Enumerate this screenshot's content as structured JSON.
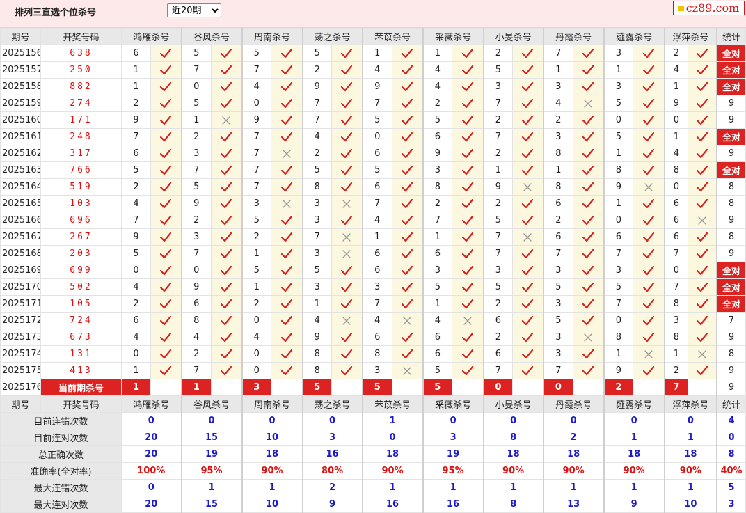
{
  "title": "排列三直选个位杀号",
  "period_select": {
    "value": "近20期"
  },
  "logo_text": "cz89.com",
  "header": {
    "issue_col": "期号",
    "draw_col": "开奖号码",
    "experts": [
      "鸿雁杀号",
      "谷风杀号",
      "周南杀号",
      "荡之杀号",
      "芣苡杀号",
      "采薇杀号",
      "小旻杀号",
      "丹霞杀号",
      "薤露杀号",
      "浮萍杀号"
    ],
    "stat_col": "统计"
  },
  "rows": [
    {
      "issue": "2025156",
      "draw": "638",
      "kills": [
        [
          6,
          1
        ],
        [
          5,
          1
        ],
        [
          5,
          1
        ],
        [
          5,
          1
        ],
        [
          1,
          1
        ],
        [
          1,
          1
        ],
        [
          2,
          1
        ],
        [
          7,
          1
        ],
        [
          3,
          1
        ],
        [
          2,
          1
        ]
      ],
      "total": "全对"
    },
    {
      "issue": "2025157",
      "draw": "250",
      "kills": [
        [
          1,
          1
        ],
        [
          7,
          1
        ],
        [
          7,
          1
        ],
        [
          2,
          1
        ],
        [
          4,
          1
        ],
        [
          4,
          1
        ],
        [
          5,
          1
        ],
        [
          1,
          1
        ],
        [
          1,
          1
        ],
        [
          4,
          1
        ]
      ],
      "total": "全对"
    },
    {
      "issue": "2025158",
      "draw": "882",
      "kills": [
        [
          1,
          1
        ],
        [
          0,
          1
        ],
        [
          4,
          1
        ],
        [
          9,
          1
        ],
        [
          9,
          1
        ],
        [
          4,
          1
        ],
        [
          3,
          1
        ],
        [
          3,
          1
        ],
        [
          3,
          1
        ],
        [
          1,
          1
        ]
      ],
      "total": "全对"
    },
    {
      "issue": "2025159",
      "draw": "274",
      "kills": [
        [
          2,
          1
        ],
        [
          5,
          1
        ],
        [
          0,
          1
        ],
        [
          7,
          1
        ],
        [
          7,
          1
        ],
        [
          2,
          1
        ],
        [
          7,
          1
        ],
        [
          4,
          0
        ],
        [
          5,
          1
        ],
        [
          9,
          1
        ]
      ],
      "total": "9"
    },
    {
      "issue": "2025160",
      "draw": "171",
      "kills": [
        [
          9,
          1
        ],
        [
          1,
          0
        ],
        [
          9,
          1
        ],
        [
          7,
          1
        ],
        [
          5,
          1
        ],
        [
          5,
          1
        ],
        [
          2,
          1
        ],
        [
          2,
          1
        ],
        [
          0,
          1
        ],
        [
          0,
          1
        ]
      ],
      "total": "9"
    },
    {
      "issue": "2025161",
      "draw": "248",
      "kills": [
        [
          7,
          1
        ],
        [
          2,
          1
        ],
        [
          7,
          1
        ],
        [
          4,
          1
        ],
        [
          0,
          1
        ],
        [
          6,
          1
        ],
        [
          7,
          1
        ],
        [
          3,
          1
        ],
        [
          5,
          1
        ],
        [
          1,
          1
        ]
      ],
      "total": "全对"
    },
    {
      "issue": "2025162",
      "draw": "317",
      "kills": [
        [
          6,
          1
        ],
        [
          3,
          1
        ],
        [
          7,
          0
        ],
        [
          2,
          1
        ],
        [
          6,
          1
        ],
        [
          9,
          1
        ],
        [
          2,
          1
        ],
        [
          8,
          1
        ],
        [
          1,
          1
        ],
        [
          4,
          1
        ]
      ],
      "total": "9"
    },
    {
      "issue": "2025163",
      "draw": "766",
      "kills": [
        [
          5,
          1
        ],
        [
          7,
          1
        ],
        [
          7,
          1
        ],
        [
          5,
          1
        ],
        [
          5,
          1
        ],
        [
          3,
          1
        ],
        [
          1,
          1
        ],
        [
          1,
          1
        ],
        [
          8,
          1
        ],
        [
          8,
          1
        ]
      ],
      "total": "全对"
    },
    {
      "issue": "2025164",
      "draw": "519",
      "kills": [
        [
          2,
          1
        ],
        [
          5,
          1
        ],
        [
          7,
          1
        ],
        [
          8,
          1
        ],
        [
          6,
          1
        ],
        [
          8,
          1
        ],
        [
          9,
          0
        ],
        [
          8,
          1
        ],
        [
          9,
          0
        ],
        [
          0,
          1
        ]
      ],
      "total": "8"
    },
    {
      "issue": "2025165",
      "draw": "103",
      "kills": [
        [
          4,
          1
        ],
        [
          9,
          1
        ],
        [
          3,
          0
        ],
        [
          3,
          0
        ],
        [
          7,
          1
        ],
        [
          2,
          1
        ],
        [
          2,
          1
        ],
        [
          6,
          1
        ],
        [
          1,
          1
        ],
        [
          6,
          1
        ]
      ],
      "total": "8"
    },
    {
      "issue": "2025166",
      "draw": "696",
      "kills": [
        [
          7,
          1
        ],
        [
          2,
          1
        ],
        [
          5,
          1
        ],
        [
          3,
          1
        ],
        [
          4,
          1
        ],
        [
          7,
          1
        ],
        [
          5,
          1
        ],
        [
          2,
          1
        ],
        [
          0,
          1
        ],
        [
          6,
          0
        ]
      ],
      "total": "9"
    },
    {
      "issue": "2025167",
      "draw": "267",
      "kills": [
        [
          9,
          1
        ],
        [
          3,
          1
        ],
        [
          2,
          1
        ],
        [
          7,
          0
        ],
        [
          1,
          1
        ],
        [
          1,
          1
        ],
        [
          7,
          0
        ],
        [
          6,
          1
        ],
        [
          6,
          1
        ],
        [
          6,
          1
        ]
      ],
      "total": "8"
    },
    {
      "issue": "2025168",
      "draw": "203",
      "kills": [
        [
          5,
          1
        ],
        [
          7,
          1
        ],
        [
          1,
          1
        ],
        [
          3,
          0
        ],
        [
          6,
          1
        ],
        [
          6,
          1
        ],
        [
          7,
          1
        ],
        [
          7,
          1
        ],
        [
          7,
          1
        ],
        [
          7,
          1
        ]
      ],
      "total": "9"
    },
    {
      "issue": "2025169",
      "draw": "699",
      "kills": [
        [
          0,
          1
        ],
        [
          0,
          1
        ],
        [
          5,
          1
        ],
        [
          5,
          1
        ],
        [
          6,
          1
        ],
        [
          3,
          1
        ],
        [
          3,
          1
        ],
        [
          3,
          1
        ],
        [
          3,
          1
        ],
        [
          0,
          1
        ]
      ],
      "total": "全对"
    },
    {
      "issue": "2025170",
      "draw": "502",
      "kills": [
        [
          4,
          1
        ],
        [
          9,
          1
        ],
        [
          1,
          1
        ],
        [
          3,
          1
        ],
        [
          3,
          1
        ],
        [
          5,
          1
        ],
        [
          5,
          1
        ],
        [
          5,
          1
        ],
        [
          5,
          1
        ],
        [
          7,
          1
        ]
      ],
      "total": "全对"
    },
    {
      "issue": "2025171",
      "draw": "105",
      "kills": [
        [
          2,
          1
        ],
        [
          6,
          1
        ],
        [
          2,
          1
        ],
        [
          1,
          1
        ],
        [
          7,
          1
        ],
        [
          1,
          1
        ],
        [
          2,
          1
        ],
        [
          3,
          1
        ],
        [
          7,
          1
        ],
        [
          8,
          1
        ]
      ],
      "total": "全对"
    },
    {
      "issue": "2025172",
      "draw": "724",
      "kills": [
        [
          6,
          1
        ],
        [
          8,
          1
        ],
        [
          0,
          1
        ],
        [
          4,
          0
        ],
        [
          4,
          0
        ],
        [
          4,
          0
        ],
        [
          6,
          1
        ],
        [
          5,
          1
        ],
        [
          0,
          1
        ],
        [
          3,
          1
        ]
      ],
      "total": "7"
    },
    {
      "issue": "2025173",
      "draw": "673",
      "kills": [
        [
          4,
          1
        ],
        [
          4,
          1
        ],
        [
          4,
          1
        ],
        [
          9,
          1
        ],
        [
          6,
          1
        ],
        [
          6,
          1
        ],
        [
          2,
          1
        ],
        [
          3,
          0
        ],
        [
          8,
          1
        ],
        [
          8,
          1
        ]
      ],
      "total": "9"
    },
    {
      "issue": "2025174",
      "draw": "131",
      "kills": [
        [
          0,
          1
        ],
        [
          2,
          1
        ],
        [
          0,
          1
        ],
        [
          8,
          1
        ],
        [
          8,
          1
        ],
        [
          6,
          1
        ],
        [
          6,
          1
        ],
        [
          3,
          1
        ],
        [
          1,
          0
        ],
        [
          1,
          0
        ]
      ],
      "total": "8"
    },
    {
      "issue": "2025175",
      "draw": "413",
      "kills": [
        [
          1,
          1
        ],
        [
          7,
          1
        ],
        [
          0,
          1
        ],
        [
          8,
          1
        ],
        [
          3,
          0
        ],
        [
          5,
          1
        ],
        [
          7,
          1
        ],
        [
          7,
          1
        ],
        [
          9,
          1
        ],
        [
          2,
          1
        ]
      ],
      "total": "9"
    }
  ],
  "current": {
    "issue": "2025176",
    "label": "当前期杀号",
    "kills": [
      "1",
      "1",
      "3",
      "5",
      "5",
      "5",
      "0",
      "0",
      "2",
      "7"
    ],
    "stat": "9"
  },
  "stats": [
    {
      "label": "目前连错次数",
      "values": [
        "0",
        "0",
        "0",
        "0",
        "1",
        "0",
        "0",
        "0",
        "0",
        "0"
      ],
      "stat": "4",
      "color": "blue"
    },
    {
      "label": "目前连对次数",
      "values": [
        "20",
        "15",
        "10",
        "3",
        "0",
        "3",
        "8",
        "2",
        "1",
        "1"
      ],
      "stat": "0",
      "color": "blue"
    },
    {
      "label": "总正确次数",
      "values": [
        "20",
        "19",
        "18",
        "16",
        "18",
        "19",
        "18",
        "18",
        "18",
        "18"
      ],
      "stat": "8",
      "color": "blue"
    },
    {
      "label": "准确率(全对率)",
      "values": [
        "100%",
        "95%",
        "90%",
        "80%",
        "90%",
        "95%",
        "90%",
        "90%",
        "90%",
        "90%"
      ],
      "stat": "40%",
      "color": "red"
    },
    {
      "label": "最大连错次数",
      "values": [
        "0",
        "1",
        "1",
        "2",
        "1",
        "1",
        "1",
        "1",
        "1",
        "1"
      ],
      "stat": "5",
      "color": "blue"
    },
    {
      "label": "最大连对次数",
      "values": [
        "20",
        "15",
        "10",
        "9",
        "16",
        "16",
        "8",
        "13",
        "9",
        "10"
      ],
      "stat": "3",
      "color": "blue"
    }
  ],
  "colors": {
    "accent_red": "#d22222",
    "check_red": "#d62020",
    "cross_gray": "#9a9a9a",
    "mark_bg": "#fcf8df",
    "header_bg": "#e8e8e8",
    "blue_text": "#1a1acc"
  }
}
